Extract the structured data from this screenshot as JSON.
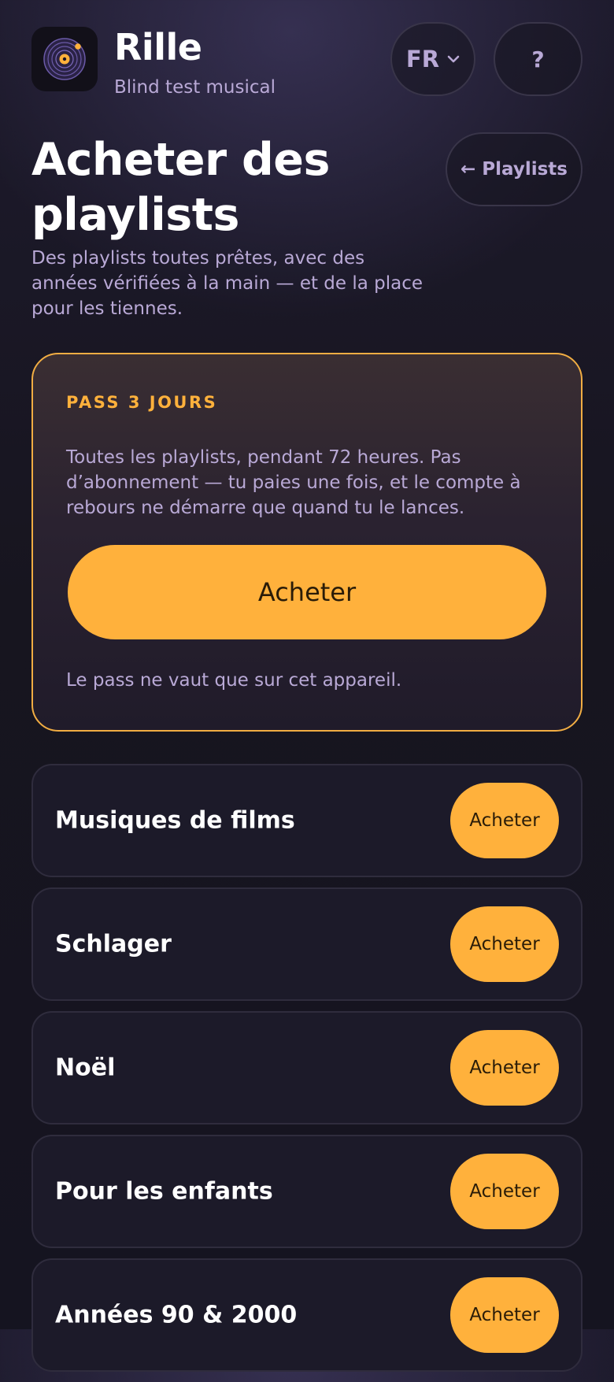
{
  "header": {
    "app_name": "Rille",
    "tagline": "Blind test musical",
    "language": "FR",
    "help_label": "?"
  },
  "page": {
    "title": "Acheter des playlists",
    "back_label": "← Playlists",
    "subtitle": "Des playlists toutes prêtes, avec des années vérifiées à la main — et de la place pour les tiennes."
  },
  "pass": {
    "eyebrow": "PASS 3 JOURS",
    "description": "Toutes les playlists, pendant 72 heures. Pas d’abonnement — tu paies une fois, et le compte à rebours ne démarre que quand tu le lances.",
    "buy_label": "Acheter",
    "note": "Le pass ne vaut que sur cet appareil."
  },
  "playlists": [
    {
      "name": "Musiques de films",
      "buy_label": "Acheter"
    },
    {
      "name": "Schlager",
      "buy_label": "Acheter"
    },
    {
      "name": "Noël",
      "buy_label": "Acheter"
    },
    {
      "name": "Pour les enfants",
      "buy_label": "Acheter"
    },
    {
      "name": "Années 90 & 2000",
      "buy_label": "Acheter"
    }
  ],
  "icons": {
    "app_icon": "vinyl-record-icon",
    "language_chevron": "chevron-down-icon"
  },
  "colors": {
    "accent": "#ffb13c",
    "muted_text": "#b9a9d6",
    "card_border": "#2f2c3d",
    "pass_border": "#f1ad43"
  }
}
